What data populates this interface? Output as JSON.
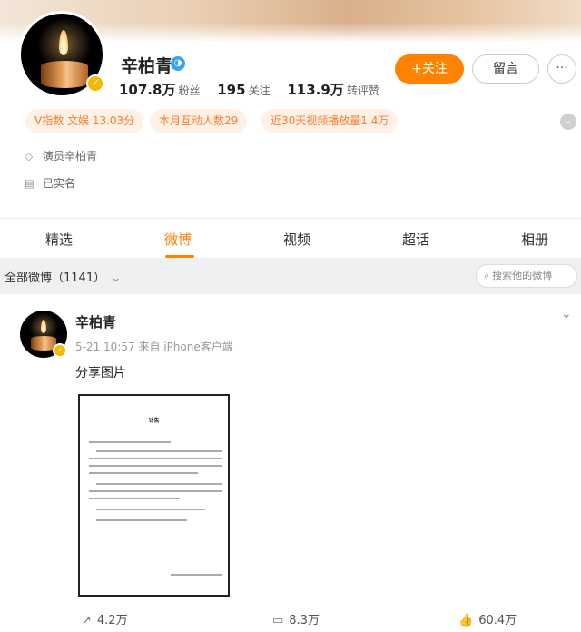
{
  "profile": {
    "name": "辛柏青",
    "stats": [
      {
        "value": "107.8万",
        "label": "粉丝"
      },
      {
        "value": "195",
        "label": "关注"
      },
      {
        "value": "113.9万",
        "label": "转评赞"
      }
    ],
    "follow_label": "+关注",
    "message_label": "留言",
    "more_label": "···",
    "tags": [
      "V指数 文娱 13.03分",
      "本月互动人数29",
      "近30天视频播放量1.4万"
    ],
    "info": [
      "演员辛柏青",
      "已实名"
    ]
  },
  "tabs": [
    "精选",
    "微博",
    "视频",
    "超话",
    "相册"
  ],
  "active_tab": "微博",
  "filter": {
    "label": "全部微博（1141）",
    "search_placeholder": "搜索他的微博"
  },
  "post": {
    "author": "辛柏青",
    "meta": "5-21 10:57  来自 iPhone客户端",
    "text": "分享图片",
    "doc_title": "讣告",
    "actions": {
      "repost": "4.2万",
      "comment": "8.3万",
      "like": "60.4万"
    }
  },
  "colors": {
    "accent": "#ff8200",
    "tag_bg": "#fff1e6",
    "tag_text": "#ff7a2e",
    "verify": "#f6b800"
  }
}
